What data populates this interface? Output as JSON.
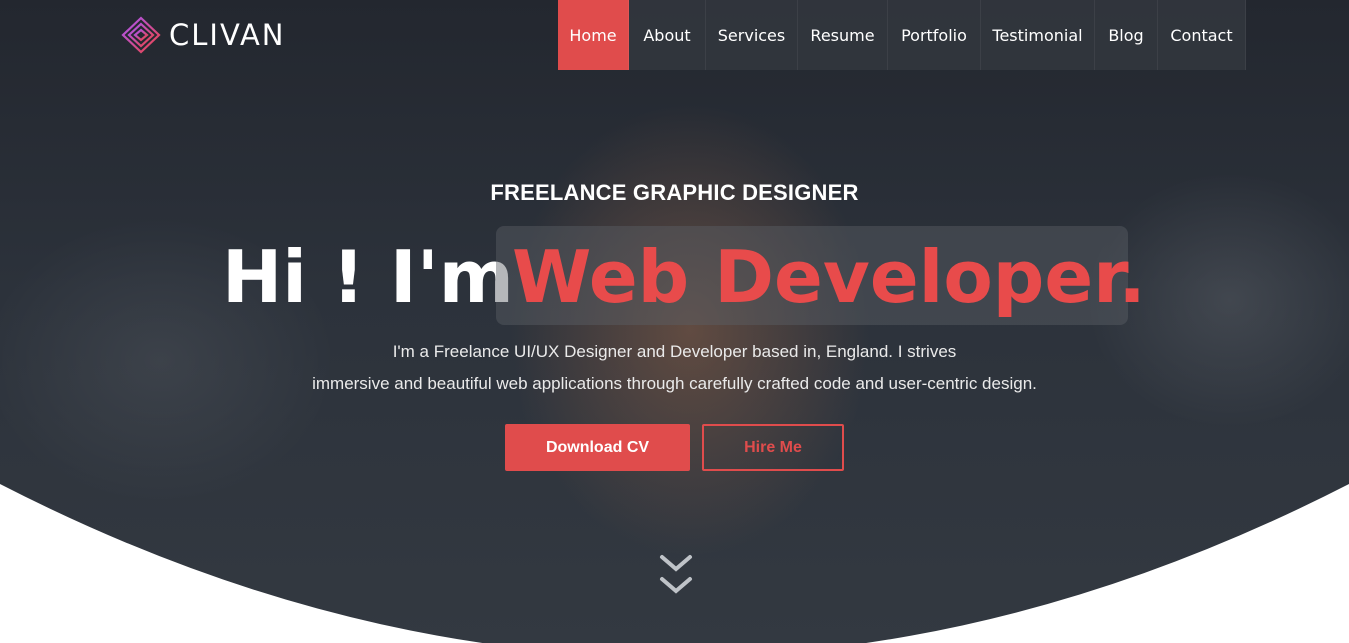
{
  "brand": {
    "name": "CLIVAN",
    "logo_icon": "nested-diamond-logo-icon"
  },
  "nav": {
    "items": [
      {
        "label": "Home",
        "active": true
      },
      {
        "label": "About",
        "active": false
      },
      {
        "label": "Services",
        "active": false
      },
      {
        "label": "Resume",
        "active": false
      },
      {
        "label": "Portfolio",
        "active": false
      },
      {
        "label": "Testimonial",
        "active": false
      },
      {
        "label": "Blog",
        "active": false
      },
      {
        "label": "Contact",
        "active": false
      }
    ]
  },
  "hero": {
    "subtitle": "FREELANCE GRAPHIC DESIGNER",
    "greeting": "Hi ! I'm",
    "role": "Web Developer.",
    "description_line1": "I'm a Freelance UI/UX Designer and Developer based in, England. I strives",
    "description_line2": "immersive and beautiful web applications through carefully crafted code and user-centric design.",
    "primary_button": "Download CV",
    "secondary_button": "Hire Me",
    "scroll_icon": "double-chevron-down-icon"
  },
  "colors": {
    "accent": "#e04c4c",
    "hero_dark": "#2a2f37",
    "text_light": "#ffffff",
    "logo_gradient_start": "#a855f7",
    "logo_gradient_end": "#ef4444"
  }
}
